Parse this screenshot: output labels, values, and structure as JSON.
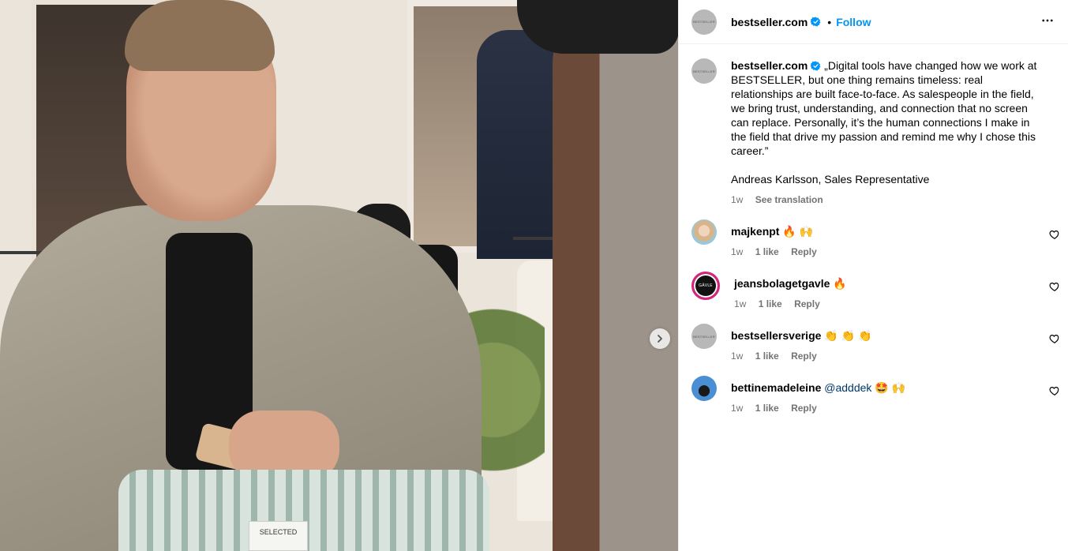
{
  "post": {
    "media_image_label": "SELECTED"
  },
  "header": {
    "avatar_text": "BESTSELLER",
    "username": "bestseller.com",
    "separator": "•",
    "follow_label": "Follow"
  },
  "caption": {
    "avatar_text": "BESTSELLER",
    "username": "bestseller.com",
    "text": "„Digital tools have changed how we work at BESTSELLER, but one thing remains timeless: real relationships are built face-to-face. As salespeople in the field, we bring trust, understanding, and connection that no screen can replace. Personally, it’s the human connections I make in the field that drive my passion and remind me why I chose this career.”",
    "signature": "Andreas Karlsson, Sales Representative",
    "age": "1w",
    "see_translation": "See translation"
  },
  "comments": [
    {
      "username": "majkenpt",
      "text": "🔥 🙌",
      "age": "1w",
      "likes": "1 like",
      "reply": "Reply"
    },
    {
      "username": "jeansbolagetgavle",
      "avatar_text": "GÄVLE",
      "text": "🔥",
      "age": "1w",
      "likes": "1 like",
      "reply": "Reply"
    },
    {
      "username": "bestsellersverige",
      "avatar_text": "BESTSELLER",
      "text": "👏 👏 👏",
      "age": "1w",
      "likes": "1 like",
      "reply": "Reply"
    },
    {
      "username": "bettinemadeleine",
      "mention": "@adddek",
      "text": "🤩 🙌",
      "age": "1w",
      "likes": "1 like",
      "reply": "Reply"
    }
  ],
  "colors": {
    "accent": "#0095f6",
    "verified": "#0095f6",
    "muted": "#737373",
    "mention": "#00376b"
  },
  "icons": [
    "verified-badge-icon",
    "more-options-icon",
    "next-arrow-icon",
    "heart-icon"
  ]
}
